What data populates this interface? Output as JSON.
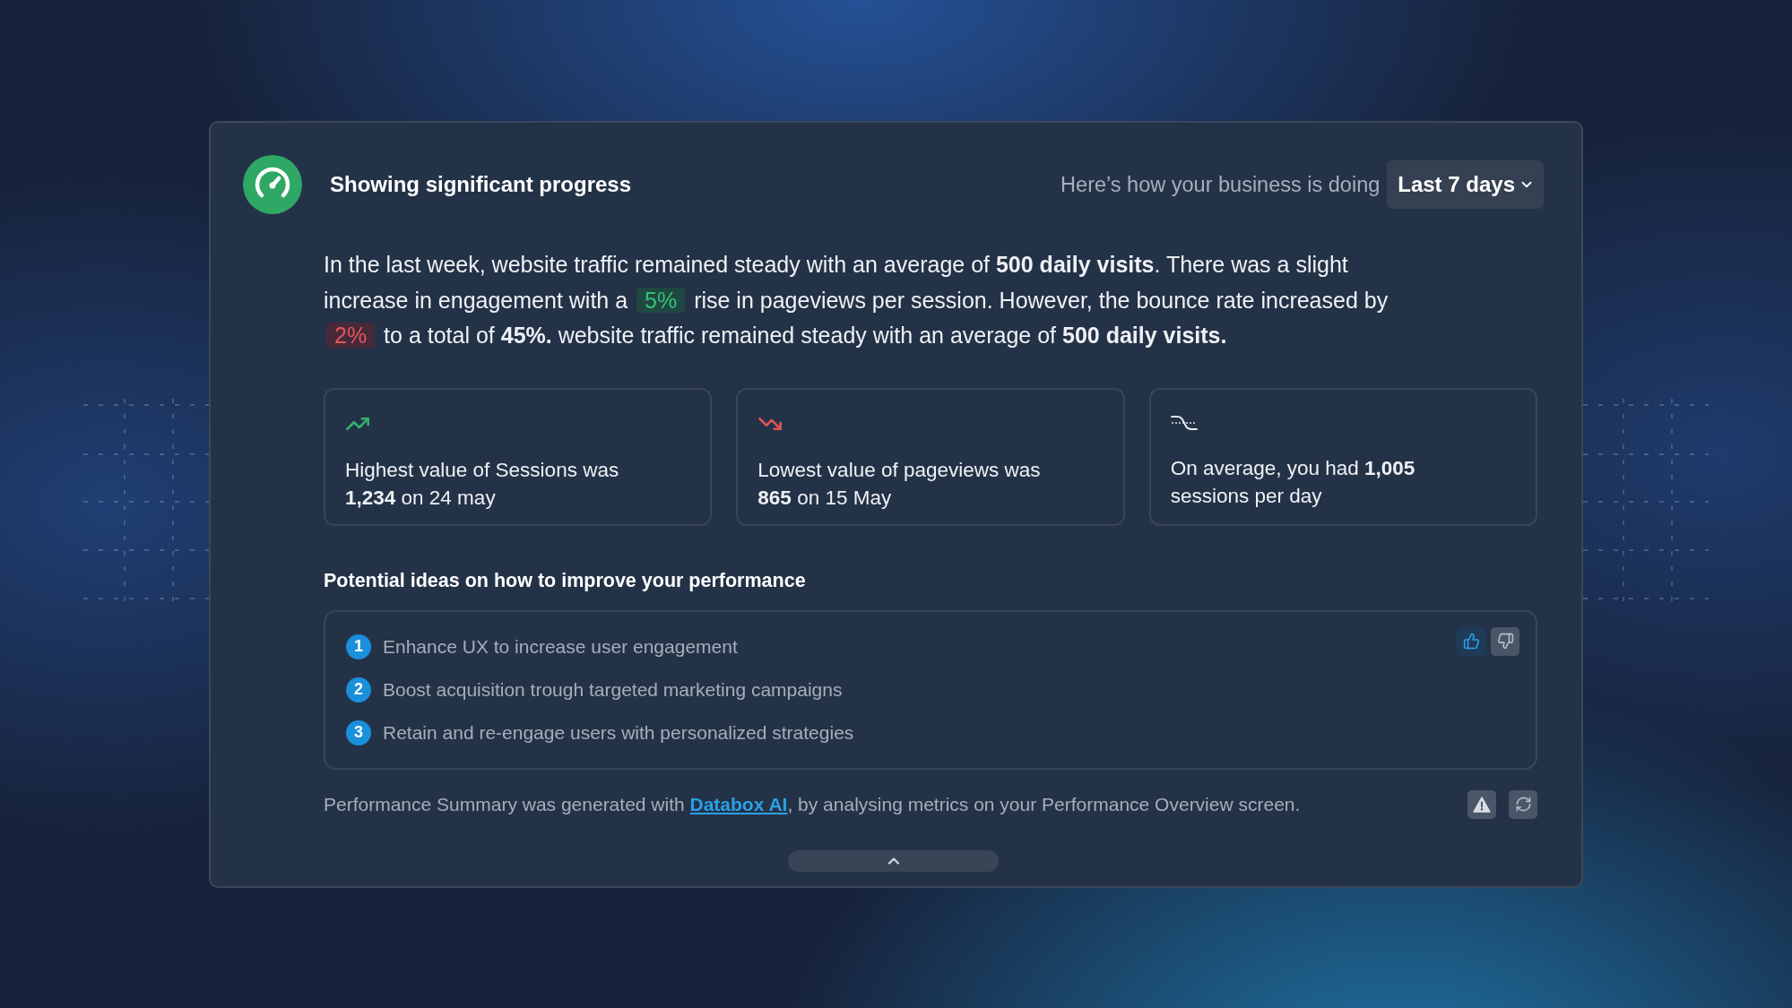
{
  "header": {
    "title": "Showing significant progress",
    "subtitle": "Here’s how your business is doing",
    "period": {
      "label": "Last 7 days"
    }
  },
  "summary": [
    {
      "kind": "plain",
      "text": "In the last week, website traffic remained steady with an average of "
    },
    {
      "kind": "strong",
      "text": "500 daily visits"
    },
    {
      "kind": "plain",
      "text": ". There was a slight increase in engagement with a "
    },
    {
      "kind": "rise",
      "text": "5%"
    },
    {
      "kind": "plain",
      "text": " rise in pageviews per session. However, the bounce rate increased by "
    },
    {
      "kind": "fall",
      "text": "2%"
    },
    {
      "kind": "plain",
      "text": " to a total of "
    },
    {
      "kind": "strong",
      "text": "45%."
    },
    {
      "kind": "plain",
      "text": " website traffic remained steady with an average of "
    },
    {
      "kind": "strong",
      "text": "500 daily visits."
    }
  ],
  "stats": [
    {
      "kind": "up",
      "text": "Highest value of Sessions was **1,234** on 24 may"
    },
    {
      "kind": "down",
      "text": "Lowest value of pageviews was **865** on 15 May"
    },
    {
      "kind": "average",
      "text": "On average, you had **1,005** sessions per day"
    }
  ],
  "ideas": {
    "title": "Potential ideas on how to improve your performance",
    "items": [
      {
        "number": "1",
        "text": "Enhance UX to increase user engagement"
      },
      {
        "number": "2",
        "text": "Boost acquisition trough targeted marketing campaigns"
      },
      {
        "number": "3",
        "text": "Retain and re-engage users with personalized strategies"
      }
    ],
    "feedback": [
      {
        "kind": "up",
        "selected": true
      },
      {
        "kind": "down",
        "selected": false
      }
    ]
  },
  "footer": {
    "before": "Performance Summary was generated with ",
    "link": "Databox AI",
    "after": ", by analysing metrics on your Performance Overview screen.",
    "actions": [
      {
        "kind": "warning"
      },
      {
        "kind": "refresh"
      }
    ]
  }
}
